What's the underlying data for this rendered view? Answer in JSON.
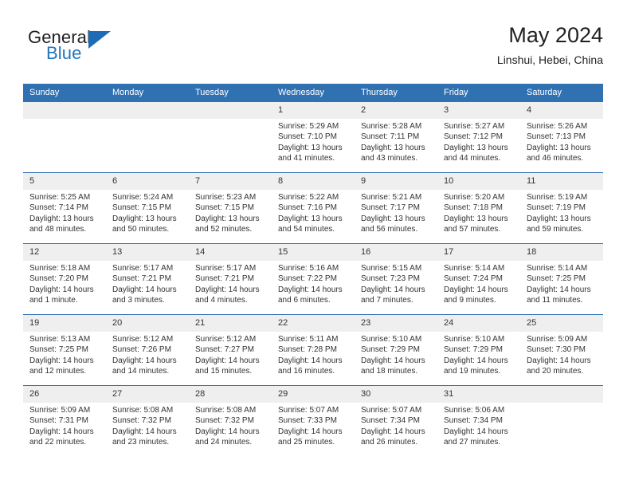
{
  "logo": {
    "word1": "General",
    "word2": "Blue",
    "accent_color": "#1e6cb3"
  },
  "header": {
    "title": "May 2024",
    "location": "Linshui, Hebei, China"
  },
  "theme": {
    "header_bg": "#3071b2",
    "daynum_bg": "#efefef",
    "text": "#333333"
  },
  "weekdays": [
    "Sunday",
    "Monday",
    "Tuesday",
    "Wednesday",
    "Thursday",
    "Friday",
    "Saturday"
  ],
  "weeks": [
    [
      {
        "day": "",
        "sunrise": "",
        "sunset": "",
        "daylight_line1": "",
        "daylight_line2": ""
      },
      {
        "day": "",
        "sunrise": "",
        "sunset": "",
        "daylight_line1": "",
        "daylight_line2": ""
      },
      {
        "day": "",
        "sunrise": "",
        "sunset": "",
        "daylight_line1": "",
        "daylight_line2": ""
      },
      {
        "day": "1",
        "sunrise": "Sunrise: 5:29 AM",
        "sunset": "Sunset: 7:10 PM",
        "daylight_line1": "Daylight: 13 hours",
        "daylight_line2": "and 41 minutes."
      },
      {
        "day": "2",
        "sunrise": "Sunrise: 5:28 AM",
        "sunset": "Sunset: 7:11 PM",
        "daylight_line1": "Daylight: 13 hours",
        "daylight_line2": "and 43 minutes."
      },
      {
        "day": "3",
        "sunrise": "Sunrise: 5:27 AM",
        "sunset": "Sunset: 7:12 PM",
        "daylight_line1": "Daylight: 13 hours",
        "daylight_line2": "and 44 minutes."
      },
      {
        "day": "4",
        "sunrise": "Sunrise: 5:26 AM",
        "sunset": "Sunset: 7:13 PM",
        "daylight_line1": "Daylight: 13 hours",
        "daylight_line2": "and 46 minutes."
      }
    ],
    [
      {
        "day": "5",
        "sunrise": "Sunrise: 5:25 AM",
        "sunset": "Sunset: 7:14 PM",
        "daylight_line1": "Daylight: 13 hours",
        "daylight_line2": "and 48 minutes."
      },
      {
        "day": "6",
        "sunrise": "Sunrise: 5:24 AM",
        "sunset": "Sunset: 7:15 PM",
        "daylight_line1": "Daylight: 13 hours",
        "daylight_line2": "and 50 minutes."
      },
      {
        "day": "7",
        "sunrise": "Sunrise: 5:23 AM",
        "sunset": "Sunset: 7:15 PM",
        "daylight_line1": "Daylight: 13 hours",
        "daylight_line2": "and 52 minutes."
      },
      {
        "day": "8",
        "sunrise": "Sunrise: 5:22 AM",
        "sunset": "Sunset: 7:16 PM",
        "daylight_line1": "Daylight: 13 hours",
        "daylight_line2": "and 54 minutes."
      },
      {
        "day": "9",
        "sunrise": "Sunrise: 5:21 AM",
        "sunset": "Sunset: 7:17 PM",
        "daylight_line1": "Daylight: 13 hours",
        "daylight_line2": "and 56 minutes."
      },
      {
        "day": "10",
        "sunrise": "Sunrise: 5:20 AM",
        "sunset": "Sunset: 7:18 PM",
        "daylight_line1": "Daylight: 13 hours",
        "daylight_line2": "and 57 minutes."
      },
      {
        "day": "11",
        "sunrise": "Sunrise: 5:19 AM",
        "sunset": "Sunset: 7:19 PM",
        "daylight_line1": "Daylight: 13 hours",
        "daylight_line2": "and 59 minutes."
      }
    ],
    [
      {
        "day": "12",
        "sunrise": "Sunrise: 5:18 AM",
        "sunset": "Sunset: 7:20 PM",
        "daylight_line1": "Daylight: 14 hours",
        "daylight_line2": "and 1 minute."
      },
      {
        "day": "13",
        "sunrise": "Sunrise: 5:17 AM",
        "sunset": "Sunset: 7:21 PM",
        "daylight_line1": "Daylight: 14 hours",
        "daylight_line2": "and 3 minutes."
      },
      {
        "day": "14",
        "sunrise": "Sunrise: 5:17 AM",
        "sunset": "Sunset: 7:21 PM",
        "daylight_line1": "Daylight: 14 hours",
        "daylight_line2": "and 4 minutes."
      },
      {
        "day": "15",
        "sunrise": "Sunrise: 5:16 AM",
        "sunset": "Sunset: 7:22 PM",
        "daylight_line1": "Daylight: 14 hours",
        "daylight_line2": "and 6 minutes."
      },
      {
        "day": "16",
        "sunrise": "Sunrise: 5:15 AM",
        "sunset": "Sunset: 7:23 PM",
        "daylight_line1": "Daylight: 14 hours",
        "daylight_line2": "and 7 minutes."
      },
      {
        "day": "17",
        "sunrise": "Sunrise: 5:14 AM",
        "sunset": "Sunset: 7:24 PM",
        "daylight_line1": "Daylight: 14 hours",
        "daylight_line2": "and 9 minutes."
      },
      {
        "day": "18",
        "sunrise": "Sunrise: 5:14 AM",
        "sunset": "Sunset: 7:25 PM",
        "daylight_line1": "Daylight: 14 hours",
        "daylight_line2": "and 11 minutes."
      }
    ],
    [
      {
        "day": "19",
        "sunrise": "Sunrise: 5:13 AM",
        "sunset": "Sunset: 7:25 PM",
        "daylight_line1": "Daylight: 14 hours",
        "daylight_line2": "and 12 minutes."
      },
      {
        "day": "20",
        "sunrise": "Sunrise: 5:12 AM",
        "sunset": "Sunset: 7:26 PM",
        "daylight_line1": "Daylight: 14 hours",
        "daylight_line2": "and 14 minutes."
      },
      {
        "day": "21",
        "sunrise": "Sunrise: 5:12 AM",
        "sunset": "Sunset: 7:27 PM",
        "daylight_line1": "Daylight: 14 hours",
        "daylight_line2": "and 15 minutes."
      },
      {
        "day": "22",
        "sunrise": "Sunrise: 5:11 AM",
        "sunset": "Sunset: 7:28 PM",
        "daylight_line1": "Daylight: 14 hours",
        "daylight_line2": "and 16 minutes."
      },
      {
        "day": "23",
        "sunrise": "Sunrise: 5:10 AM",
        "sunset": "Sunset: 7:29 PM",
        "daylight_line1": "Daylight: 14 hours",
        "daylight_line2": "and 18 minutes."
      },
      {
        "day": "24",
        "sunrise": "Sunrise: 5:10 AM",
        "sunset": "Sunset: 7:29 PM",
        "daylight_line1": "Daylight: 14 hours",
        "daylight_line2": "and 19 minutes."
      },
      {
        "day": "25",
        "sunrise": "Sunrise: 5:09 AM",
        "sunset": "Sunset: 7:30 PM",
        "daylight_line1": "Daylight: 14 hours",
        "daylight_line2": "and 20 minutes."
      }
    ],
    [
      {
        "day": "26",
        "sunrise": "Sunrise: 5:09 AM",
        "sunset": "Sunset: 7:31 PM",
        "daylight_line1": "Daylight: 14 hours",
        "daylight_line2": "and 22 minutes."
      },
      {
        "day": "27",
        "sunrise": "Sunrise: 5:08 AM",
        "sunset": "Sunset: 7:32 PM",
        "daylight_line1": "Daylight: 14 hours",
        "daylight_line2": "and 23 minutes."
      },
      {
        "day": "28",
        "sunrise": "Sunrise: 5:08 AM",
        "sunset": "Sunset: 7:32 PM",
        "daylight_line1": "Daylight: 14 hours",
        "daylight_line2": "and 24 minutes."
      },
      {
        "day": "29",
        "sunrise": "Sunrise: 5:07 AM",
        "sunset": "Sunset: 7:33 PM",
        "daylight_line1": "Daylight: 14 hours",
        "daylight_line2": "and 25 minutes."
      },
      {
        "day": "30",
        "sunrise": "Sunrise: 5:07 AM",
        "sunset": "Sunset: 7:34 PM",
        "daylight_line1": "Daylight: 14 hours",
        "daylight_line2": "and 26 minutes."
      },
      {
        "day": "31",
        "sunrise": "Sunrise: 5:06 AM",
        "sunset": "Sunset: 7:34 PM",
        "daylight_line1": "Daylight: 14 hours",
        "daylight_line2": "and 27 minutes."
      },
      {
        "day": "",
        "sunrise": "",
        "sunset": "",
        "daylight_line1": "",
        "daylight_line2": ""
      }
    ]
  ]
}
